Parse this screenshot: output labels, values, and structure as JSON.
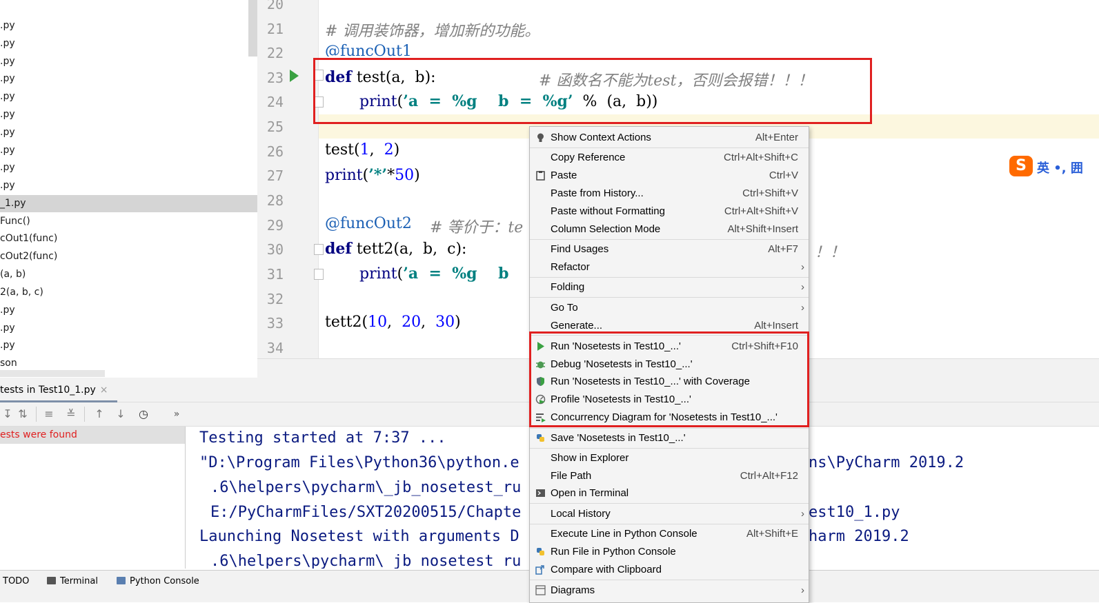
{
  "project_tree": {
    "items": [
      ".py",
      ".py",
      ".py",
      ".py",
      ".py",
      ".py",
      ".py",
      ".py",
      ".py",
      ".py",
      "_1.py",
      "Func()",
      "cOut1(func)",
      "cOut2(func)",
      "(a, b)",
      "2(a, b, c)",
      ".py",
      ".py",
      ".py",
      "son"
    ],
    "selected_index": 10
  },
  "editor": {
    "line_numbers": [
      "20",
      "21",
      "22",
      "23",
      "24",
      "25",
      "26",
      "27",
      "28",
      "29",
      "30",
      "31",
      "32",
      "33",
      "34"
    ],
    "lines": {
      "l21": "# 调用装饰器，增加新的功能。",
      "l22": "@funcOut1",
      "l23_kw": "def",
      "l23_rest": " test(a,  b):",
      "l23_comment": "# 函数名不能为test，否则会报错！！！",
      "l24_fn": "print",
      "l24_open": "(",
      "l24_str": "’a  =  %g    b  =  %g’",
      "l24_rest": "  %  (a,  b))",
      "l26_name": "test",
      "l26_open": "(",
      "l26_n1": "1",
      "l26_mid": ",  ",
      "l26_n2": "2",
      "l26_close": ")",
      "l27_fn": "print",
      "l27_open": "(",
      "l27_str": "’*’",
      "l27_op": "*",
      "l27_num": "50",
      "l27_close": ")",
      "l29_dec": "@funcOut2",
      "l29_comment": "# 等价于：te",
      "l30_kw": "def",
      "l30_rest": " tett2(a,  b,  c):",
      "l30_tail": "！！",
      "l31_fn": "print",
      "l31_open": "(",
      "l31_str": "’a  =  %g    b",
      "l33_name": "tett2",
      "l33_open": "(",
      "l33_n1": "10",
      "l33_sep1": ",  ",
      "l33_n2": "20",
      "l33_sep2": ",  ",
      "l33_n3": "30",
      "l33_close": ")"
    }
  },
  "ime": {
    "logo": "S",
    "text": "英 •, 囲"
  },
  "run_panel": {
    "tab_label": "tests in Test10_1.py",
    "tab_close": "×",
    "status": "ests were found",
    "more": "»",
    "console_lines": [
      "Testing started at 7:37 ...",
      "\"D:\\Program Files\\Python36\\python.e",
      ".6\\helpers\\pycharm\\_jb_nosetest_ru",
      "E:/PyCharmFiles/SXT20200515/Chapte",
      "Launching Nosetest with arguments D",
      ".6\\helpers\\pycharm\\_jb_nosetest_ru"
    ],
    "console_right": [
      "ns\\PyCharm 2019.2",
      "est10_1.py",
      "harm 2019.2"
    ]
  },
  "bottom_bar": {
    "todo": "TODO",
    "terminal": "Terminal",
    "python_console": "Python Console"
  },
  "context_menu": {
    "items": [
      {
        "label": "Show Context Actions",
        "shortcut": "Alt+Enter",
        "icon": "bulb-icon"
      },
      {
        "label": "Copy Reference",
        "shortcut": "Ctrl+Alt+Shift+C"
      },
      {
        "label": "Paste",
        "shortcut": "Ctrl+V",
        "icon": "clipboard-icon"
      },
      {
        "label": "Paste from History...",
        "shortcut": "Ctrl+Shift+V"
      },
      {
        "label": "Paste without Formatting",
        "shortcut": "Ctrl+Alt+Shift+V"
      },
      {
        "label": "Column Selection Mode",
        "shortcut": "Alt+Shift+Insert"
      },
      {
        "label": "Find Usages",
        "shortcut": "Alt+F7"
      },
      {
        "label": "Refactor",
        "submenu": "›"
      },
      {
        "label": "Folding",
        "submenu": "›"
      },
      {
        "label": "Go To",
        "submenu": "›"
      },
      {
        "label": "Generate...",
        "shortcut": "Alt+Insert"
      },
      {
        "label": "Run 'Nosetests in Test10_...'",
        "shortcut": "Ctrl+Shift+F10",
        "icon": "run-icon"
      },
      {
        "label": "Debug 'Nosetests in Test10_...'",
        "icon": "bug-icon"
      },
      {
        "label": "Run 'Nosetests in Test10_...' with Coverage",
        "icon": "coverage-icon"
      },
      {
        "label": "Profile 'Nosetests in Test10_...'",
        "icon": "profile-icon"
      },
      {
        "label": "Concurrency Diagram for 'Nosetests in Test10_...'",
        "icon": "concurrency-icon"
      },
      {
        "label": "Save 'Nosetests in Test10_...'",
        "icon": "python-icon"
      },
      {
        "label": "Show in Explorer"
      },
      {
        "label": "File Path",
        "shortcut": "Ctrl+Alt+F12"
      },
      {
        "label": "Open in Terminal",
        "icon": "terminal-icon"
      },
      {
        "label": "Local History",
        "submenu": "›"
      },
      {
        "label": "Execute Line in Python Console",
        "shortcut": "Alt+Shift+E"
      },
      {
        "label": "Run File in Python Console",
        "icon": "python-icon"
      },
      {
        "label": "Compare with Clipboard",
        "icon": "compare-icon"
      },
      {
        "label": "Diagrams",
        "submenu": "›",
        "icon": "diagram-icon"
      }
    ]
  },
  "colors": {
    "highlight_box": "#e02020",
    "run_green": "#3aa142",
    "keyword": "#000080",
    "string": "#008080",
    "number": "#0000ff",
    "console_text": "#0a1a80",
    "error_text": "#e02020"
  }
}
